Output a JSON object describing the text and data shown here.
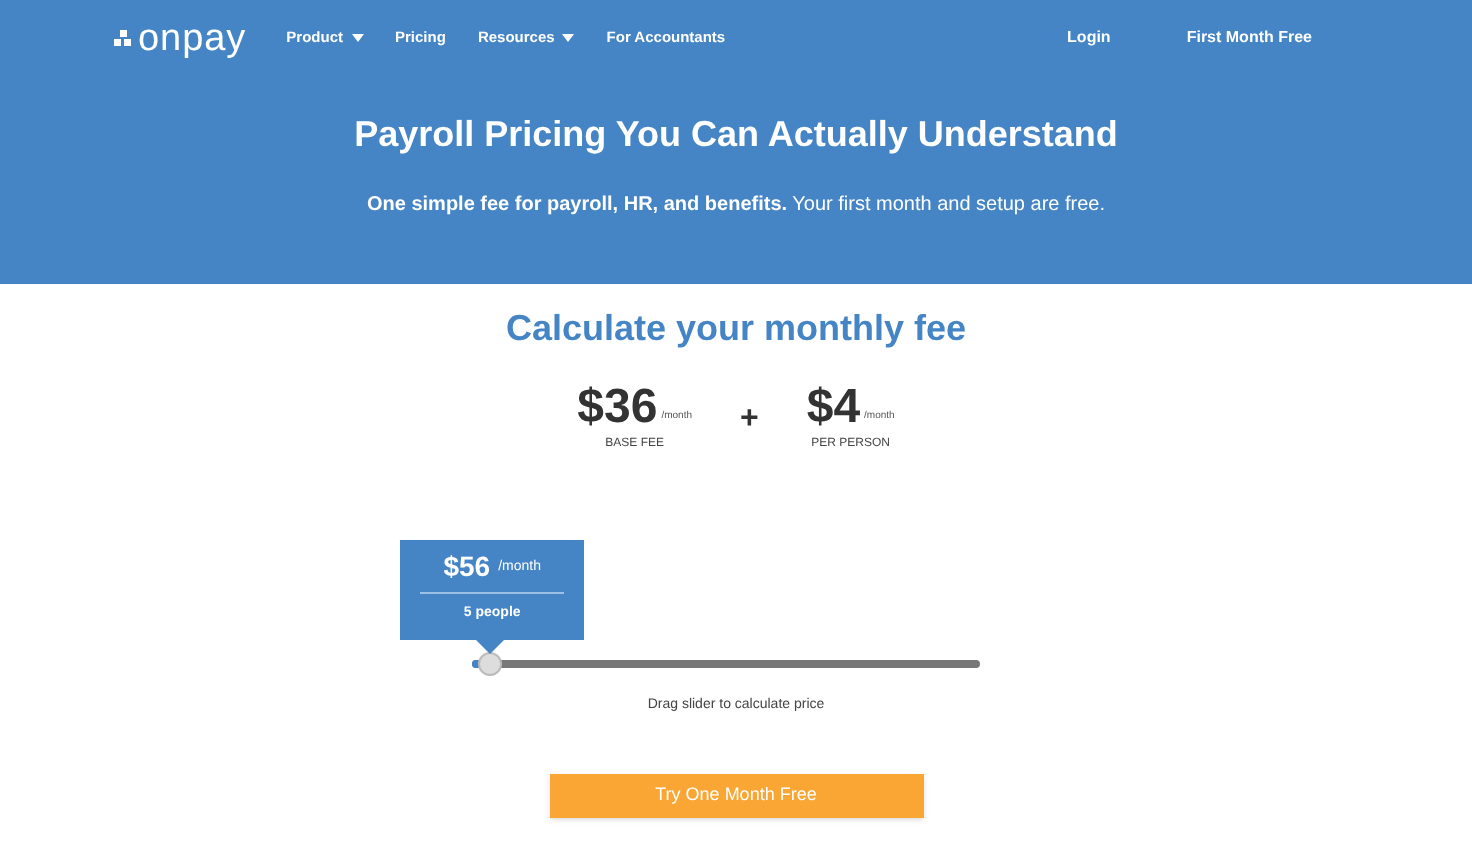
{
  "header": {
    "logo": "onpay",
    "nav": [
      {
        "label": "Product",
        "dropdown": true
      },
      {
        "label": "Pricing",
        "dropdown": false
      },
      {
        "label": "Resources",
        "dropdown": true
      },
      {
        "label": "For Accountants",
        "dropdown": false
      }
    ],
    "actions": [
      "Login",
      "First Month Free"
    ],
    "title": "Payroll Pricing You Can Actually Understand",
    "subtitle": "**One simple fee for payroll, HR, and benefits.** Your first month and setup are free."
  },
  "calculator": {
    "title": "Calculate your monthly fee",
    "fees": [
      {
        "amount": "$36",
        "unit": "/month",
        "label": "BASE FEE"
      },
      {
        "amount": "$4",
        "unit": "/month",
        "label": "PER PERSON"
      }
    ],
    "operator": "+",
    "tooltip": {
      "amount": "$56",
      "unit": "/month",
      "people": "5 people"
    },
    "slider": {
      "level": 0.02
    },
    "hint": "Drag slider to calculate price",
    "button": "Try One Month Free"
  }
}
